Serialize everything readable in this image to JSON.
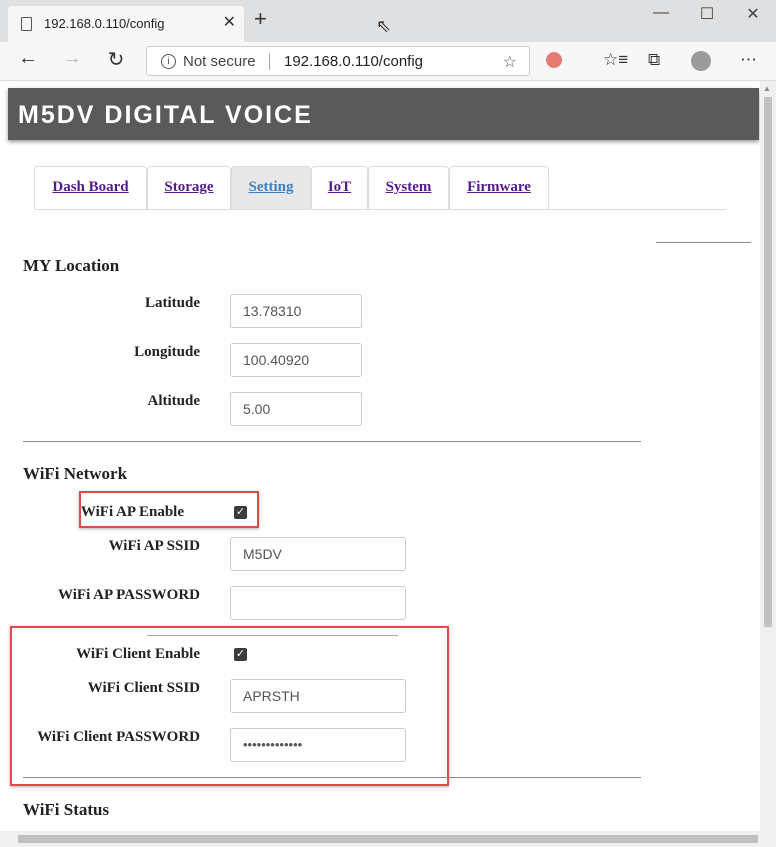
{
  "browser": {
    "tab_title": "192.168.0.110/config",
    "close_glyph": "✕",
    "new_tab_glyph": "+",
    "security_label": "Not secure",
    "url": "192.168.0.110/config"
  },
  "app": {
    "title": "M5DV DIGITAL VOICE"
  },
  "nav": {
    "tabs": [
      {
        "label": "Dash Board"
      },
      {
        "label": "Storage"
      },
      {
        "label": "Setting"
      },
      {
        "label": "IoT"
      },
      {
        "label": "System"
      },
      {
        "label": "Firmware"
      }
    ],
    "active": "Setting"
  },
  "location": {
    "heading": "MY Location",
    "latitude": {
      "label": "Latitude",
      "value": "13.78310"
    },
    "longitude": {
      "label": "Longitude",
      "value": "100.40920"
    },
    "altitude": {
      "label": "Altitude",
      "value": "5.00"
    }
  },
  "wifi": {
    "heading": "WiFi Network",
    "ap_enable": {
      "label": "WiFi AP Enable",
      "checked": true
    },
    "ap_ssid": {
      "label": "WiFi AP SSID",
      "value": "M5DV"
    },
    "ap_password": {
      "label": "WiFi AP PASSWORD",
      "value": ""
    },
    "client_enable": {
      "label": "WiFi Client Enable",
      "checked": true
    },
    "client_ssid": {
      "label": "WiFi Client SSID",
      "value": "APRSTH"
    },
    "client_password": {
      "label": "WiFi Client PASSWORD",
      "value": "•••••••••••••"
    }
  },
  "status": {
    "heading": "WiFi Status"
  },
  "colors": {
    "header_bg": "#5a5a5a",
    "highlight_border": "#e04a4a",
    "link": "#551a8b",
    "active_tab_text": "#3b7fc4"
  },
  "icons": [
    "page-icon",
    "close-icon",
    "plus-icon",
    "back-arrow-icon",
    "forward-arrow-icon",
    "refresh-icon",
    "info-icon",
    "star-icon",
    "extension-icon",
    "favorites-icon",
    "collections-icon",
    "profile-icon",
    "more-icon"
  ]
}
